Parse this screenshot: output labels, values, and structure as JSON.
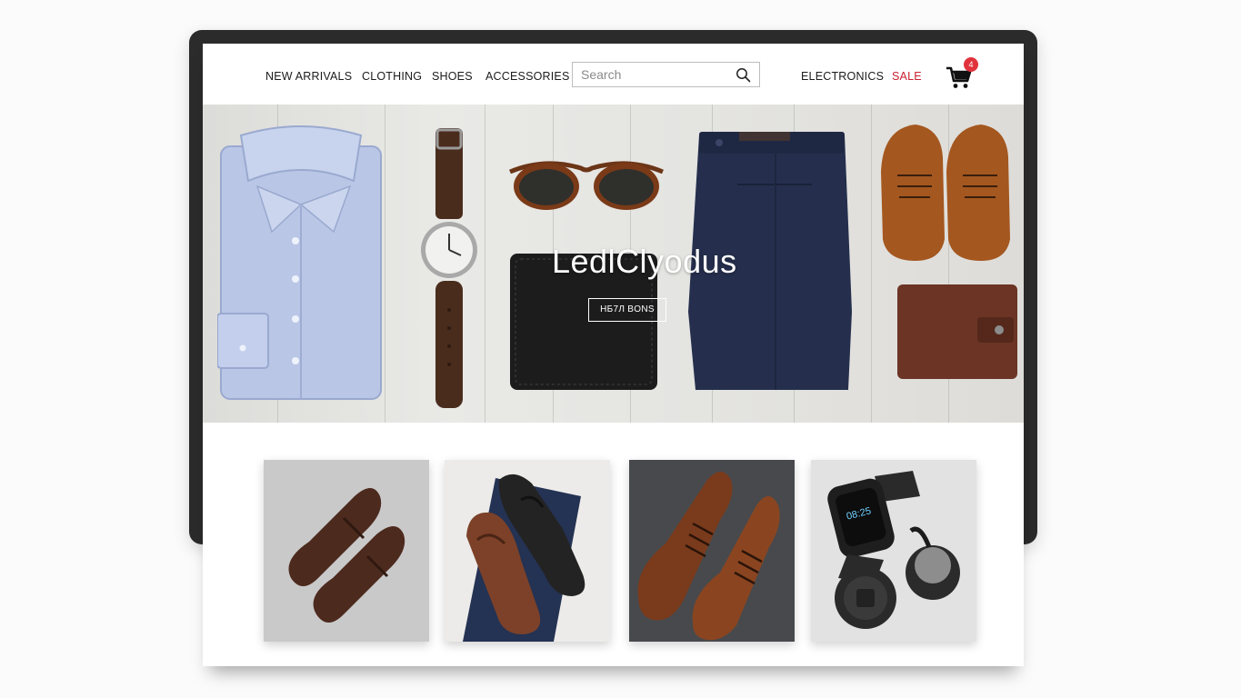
{
  "nav": {
    "items": [
      "NEW ARRIVALS",
      "CLOTHING",
      "SHOES",
      "ACCESSORIES"
    ],
    "right_items": [
      "ELECTRONICS",
      "SALE"
    ]
  },
  "search": {
    "placeholder": "Search"
  },
  "cart": {
    "count": "4"
  },
  "hero": {
    "title": "LedlClyodus",
    "button_label": "HБ7Л BONS"
  },
  "colors": {
    "sale": "#c8202f",
    "cart_badge": "#e1333c",
    "frame": "#2b2b2b"
  },
  "products": [
    {
      "icon": "brown-loafers-image"
    },
    {
      "icon": "brown-and-black-loafers-image"
    },
    {
      "icon": "brown-derby-shoes-image"
    },
    {
      "icon": "smartwatch-and-charger-image"
    }
  ]
}
